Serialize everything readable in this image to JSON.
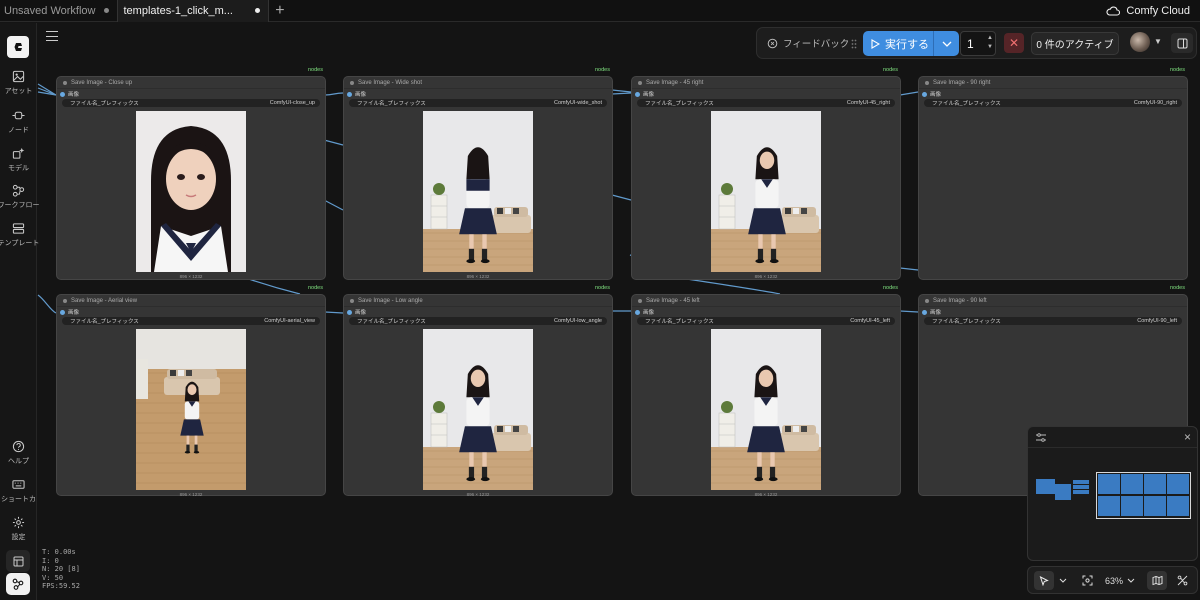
{
  "tabs": [
    {
      "label": "Unsaved Workflow",
      "active": false
    },
    {
      "label": "templates-1_click_m...",
      "active": true
    }
  ],
  "cloud": {
    "label": "Comfy Cloud"
  },
  "sidebar": {
    "items": [
      {
        "label": "アセット",
        "icon": "image-icon"
      },
      {
        "label": "ノード",
        "icon": "node-icon"
      },
      {
        "label": "モデル",
        "icon": "model-icon"
      },
      {
        "label": "ワークフロー",
        "icon": "workflow-icon"
      },
      {
        "label": "テンプレート",
        "icon": "template-icon"
      },
      {
        "label": "ヘルプ",
        "icon": "help-icon"
      },
      {
        "label": "ショートカ",
        "icon": "keyboard-icon"
      },
      {
        "label": "設定",
        "icon": "gear-icon"
      }
    ]
  },
  "stats": {
    "t": "T: 0.00s",
    "i": "I: 0",
    "n": "N: 20 [8]",
    "v": "V: 50",
    "fps": "FPS:59.52"
  },
  "actionbar": {
    "feedback": "フィードバック",
    "run": "実行する",
    "queue_count": "1",
    "active": "0 件のアクティブ"
  },
  "nodes": [
    {
      "title": "Save Image - Close up",
      "input": "画像",
      "widget_label": "ファイル名_プレフィックス",
      "widget_value": "ComfyUI-close_up",
      "badge": "nodes",
      "dims": "896 × 1232",
      "scene": "closeup"
    },
    {
      "title": "Save Image - Wide shot",
      "input": "画像",
      "widget_label": "ファイル名_プレフィックス",
      "widget_value": "ComfyUI-wide_shot",
      "badge": "nodes",
      "dims": "896 × 1232",
      "scene": "back"
    },
    {
      "title": "Save Image - 45 right",
      "input": "画像",
      "widget_label": "ファイル名_プレフィックス",
      "widget_value": "ComfyUI-45_right",
      "badge": "nodes",
      "dims": "896 × 1232",
      "scene": "side"
    },
    {
      "title": "Save Image - 90 right",
      "input": "画像",
      "widget_label": "ファイル名_プレフィックス",
      "widget_value": "ComfyUI-90_right",
      "badge": "nodes",
      "dims": "",
      "scene": "none"
    },
    {
      "title": "Save Image - Aerial view",
      "input": "画像",
      "widget_label": "ファイル名_プレフィックス",
      "widget_value": "ComfyUI-aerial_view",
      "badge": "nodes",
      "dims": "896 × 1232",
      "scene": "aerial"
    },
    {
      "title": "Save Image - Low angle",
      "input": "画像",
      "widget_label": "ファイル名_プレフィックス",
      "widget_value": "ComfyUI-low_angle",
      "badge": "nodes",
      "dims": "896 × 1232",
      "scene": "front"
    },
    {
      "title": "Save Image - 45 left",
      "input": "画像",
      "widget_label": "ファイル名_プレフィックス",
      "widget_value": "ComfyUI-45_left",
      "badge": "nodes",
      "dims": "896 × 1232",
      "scene": "front2"
    },
    {
      "title": "Save Image - 90 left",
      "input": "画像",
      "widget_label": "ファイル名_プレフィックス",
      "widget_value": "ComfyUI-90_left",
      "badge": "nodes",
      "dims": "",
      "scene": "none"
    }
  ],
  "zoom": "63%",
  "colors": {
    "accent": "#3f8de0",
    "wire": "#6aa9e0",
    "badge": "#7fe07f",
    "cancel": "#552427"
  }
}
